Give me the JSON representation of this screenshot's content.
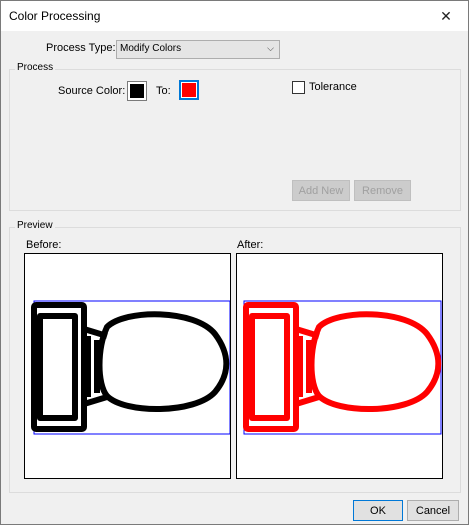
{
  "window": {
    "title": "Color Processing"
  },
  "icons": {
    "close": "close-icon",
    "dropdown": "chevron-down-icon"
  },
  "process_type": {
    "label": "Process Type:",
    "value": "Modify Colors"
  },
  "process": {
    "group_label": "Process",
    "source_color_label": "Source Color:",
    "source_color": "#000000",
    "to_label": "To:",
    "to_color": "#ff0000",
    "tolerance_label": "Tolerance",
    "tolerance_checked": false,
    "add_new_label": "Add New",
    "remove_label": "Remove"
  },
  "preview": {
    "group_label": "Preview",
    "before_label": "Before:",
    "after_label": "After:",
    "before_color": "#000000",
    "after_color": "#ff0000",
    "frame_color": "#0000ff"
  },
  "buttons": {
    "ok_label": "OK",
    "cancel_label": "Cancel"
  }
}
